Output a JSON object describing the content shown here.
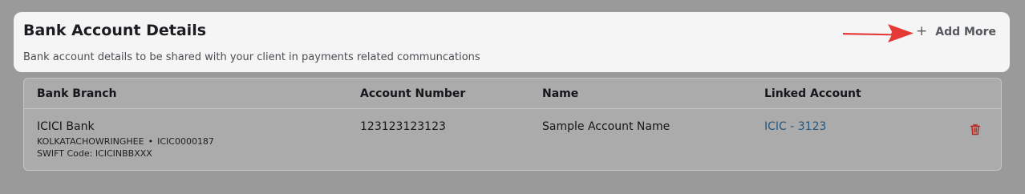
{
  "header": {
    "title": "Bank Account Details",
    "subtitle": "Bank account details to be shared with your client in payments related communcations",
    "add_more_label": "Add More",
    "add_more_icon": "plus-icon",
    "annotation_color": "#e53935"
  },
  "table": {
    "columns": [
      "Bank Branch",
      "Account Number",
      "Name",
      "Linked Account"
    ],
    "rows": [
      {
        "bank_name": "ICICI Bank",
        "branch": "KOLKATACHOWRINGHEE",
        "separator": "•",
        "ifsc": "ICIC0000187",
        "swift": "SWIFT Code: ICICINBBXXX",
        "account_number": "123123123123",
        "name": "Sample Account Name",
        "linked_account": "ICIC - 3123",
        "action_icon": "trash-icon"
      }
    ]
  },
  "colors": {
    "link": "#24577f",
    "delete": "#b3261e",
    "header_bg": "#f5f5f6",
    "backdrop": "#9a9a9a"
  }
}
